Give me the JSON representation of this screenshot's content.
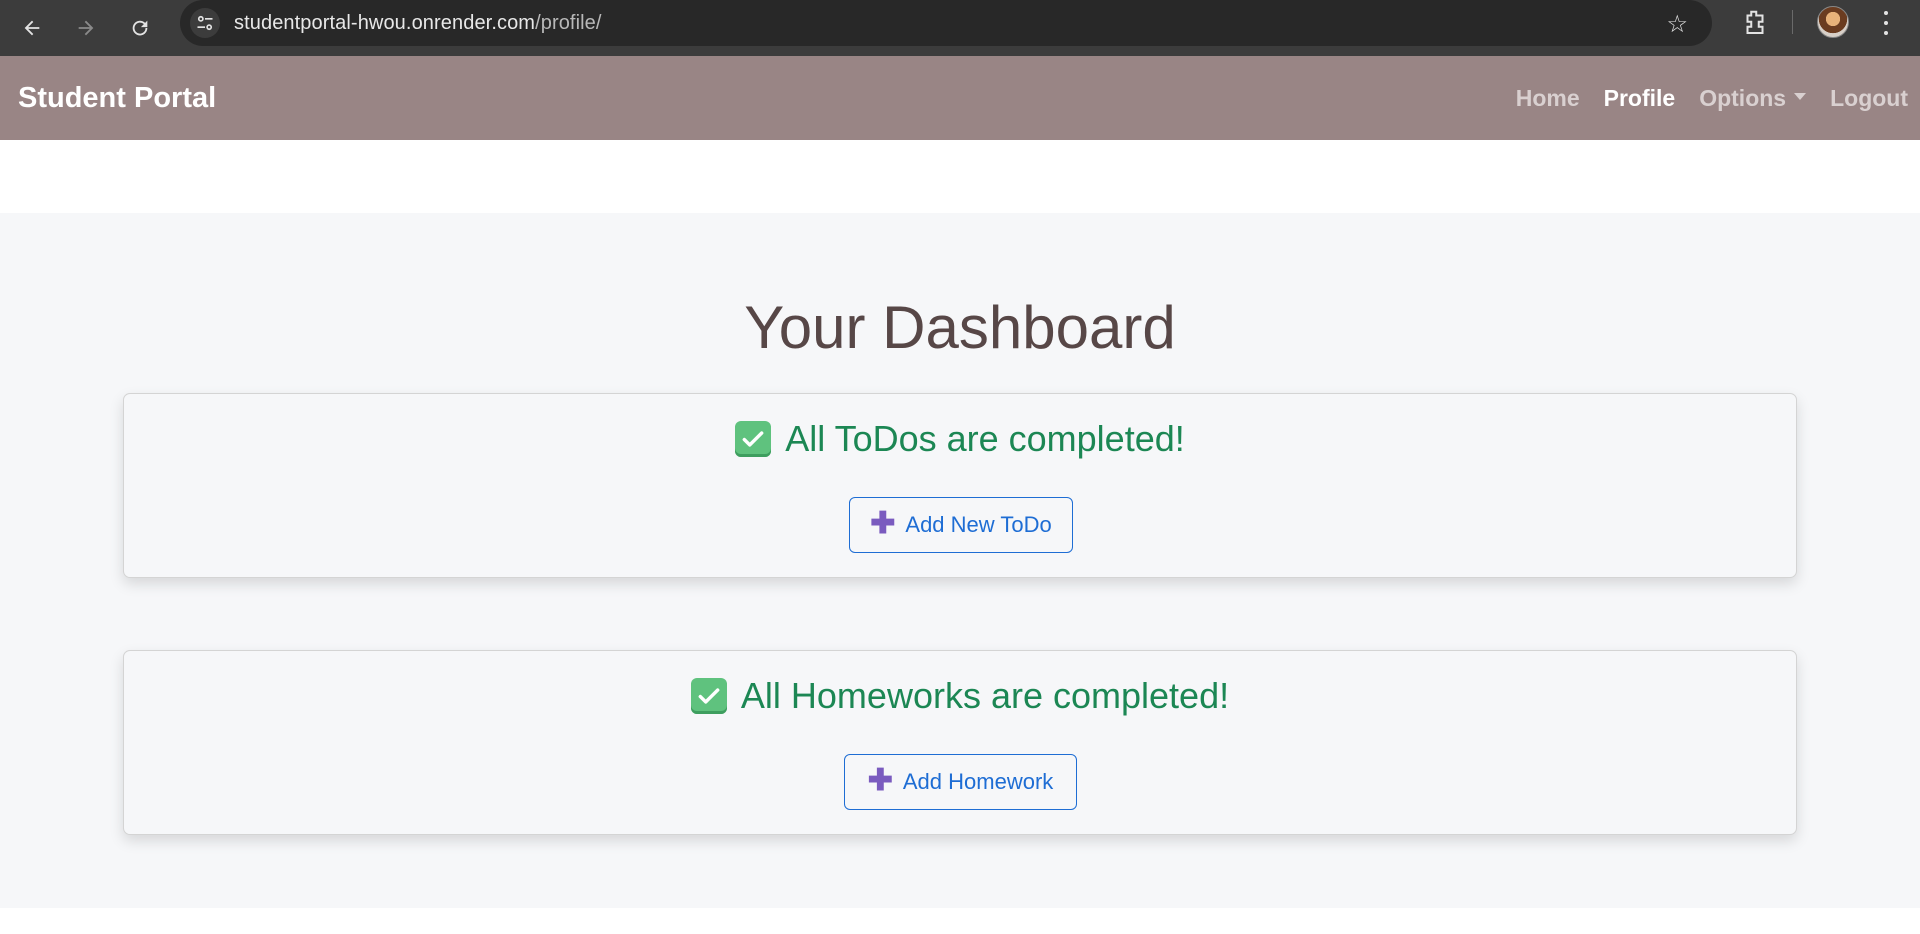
{
  "browser": {
    "url_host": "studentportal-hwou.onrender.com",
    "url_path": "/profile/",
    "icons": [
      "back-icon",
      "forward-icon",
      "reload-icon",
      "site-settings-icon",
      "star-icon",
      "extensions-icon",
      "profile-avatar",
      "kebab-menu-icon"
    ]
  },
  "navbar": {
    "brand": "Student Portal",
    "links": {
      "home": "Home",
      "profile": "Profile",
      "options": "Options",
      "logout": "Logout"
    },
    "background": "#998585"
  },
  "main": {
    "title": "Your Dashboard",
    "todos": {
      "message": "All ToDos are completed!",
      "button": "Add New ToDo"
    },
    "homeworks": {
      "message": "All Homeworks are completed!",
      "button": "Add Homework"
    }
  },
  "colors": {
    "success_text": "#1c8754",
    "button_blue": "#1e6dd4",
    "title_text": "#574747"
  }
}
